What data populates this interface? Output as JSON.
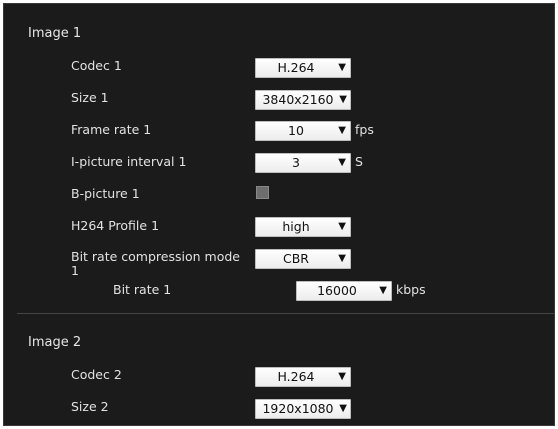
{
  "image1": {
    "title": "Image 1",
    "codec": {
      "label": "Codec 1",
      "value": "H.264"
    },
    "size": {
      "label": "Size 1",
      "value": "3840x2160"
    },
    "frame_rate": {
      "label": "Frame rate 1",
      "value": "10",
      "unit": "fps"
    },
    "ipicture": {
      "label": "I-picture interval 1",
      "value": "3",
      "unit": "S"
    },
    "bpicture": {
      "label": "B-picture 1",
      "checked": false
    },
    "profile": {
      "label": "H264 Profile 1",
      "value": "high"
    },
    "compression": {
      "label_line1": "Bit rate compression mode",
      "label_line2": "1",
      "value": "CBR"
    },
    "bitrate": {
      "label": "Bit rate 1",
      "value": "16000",
      "unit": "kbps"
    }
  },
  "image2": {
    "title": "Image 2",
    "codec": {
      "label": "Codec 2",
      "value": "H.264"
    },
    "size": {
      "label": "Size 2",
      "value": "1920x1080"
    }
  },
  "icons": {
    "dropdown": "chevron-down-icon"
  }
}
